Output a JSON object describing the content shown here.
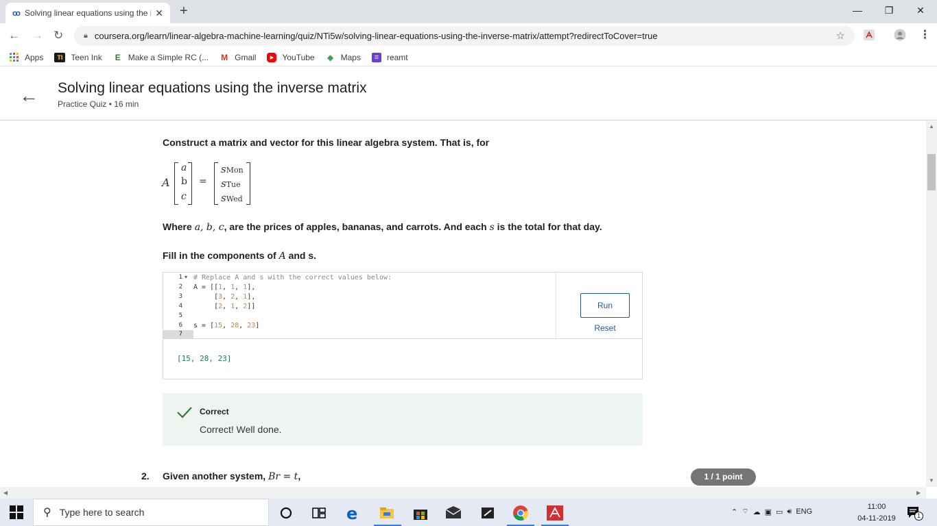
{
  "browser": {
    "tab_title": "Solving linear equations using the inverse matrix",
    "tab_close": "✕",
    "new_tab": "+",
    "url": "coursera.org/learn/linear-algebra-machine-learning/quiz/NTi5w/solving-linear-equations-using-the-inverse-matrix/attempt?redirectToCover=true",
    "window_buttons": [
      "—",
      "❐",
      "✕"
    ]
  },
  "bookmarks": [
    {
      "label": "Apps",
      "icon": "apps-grid-icon",
      "color": "#4285f4"
    },
    {
      "label": "Teen Ink",
      "icon": "teen-ink-icon",
      "color": "#1a1a1a",
      "glyph": "TI"
    },
    {
      "label": "Make a Simple RC (...",
      "icon": "instructables-icon",
      "color": "#2e7d32",
      "glyph": "E"
    },
    {
      "label": "Gmail",
      "icon": "gmail-icon",
      "color": "#d93025",
      "glyph": "M"
    },
    {
      "label": "YouTube",
      "icon": "youtube-icon",
      "color": "#ff0000",
      "glyph": "▶"
    },
    {
      "label": "Maps",
      "icon": "maps-icon",
      "color": "#34a853",
      "glyph": "◆"
    },
    {
      "label": "reamt",
      "icon": "reamt-icon",
      "color": "#6a3fd1",
      "glyph": "≡"
    }
  ],
  "header": {
    "title": "Solving linear equations using the inverse matrix",
    "subtitle": "Practice Quiz • 16 min"
  },
  "question1": {
    "prompt": "Construct a matrix and vector for this linear algebra system. That is, for",
    "equation": {
      "matrix": "A",
      "vars": [
        "a",
        "b",
        "c"
      ],
      "equals": "=",
      "rhs": [
        "Mon",
        "Tue",
        "Wed"
      ],
      "rhs_symbol": "s"
    },
    "where_text": {
      "pre": "Where ",
      "vars": "a, b, c",
      "mid": ", are the prices of apples, bananas, and carrots. And each ",
      "s": "s",
      "post": " is the total for that day."
    },
    "fill_text": {
      "pre": "Fill in the components of ",
      "A": "A",
      "post": " and s."
    },
    "editor": {
      "line_numbers": [
        "1",
        "2",
        "3",
        "4",
        "5",
        "6",
        "7"
      ],
      "fold_marker": "▾",
      "lines": [
        "# Replace A and s with the correct values below:",
        "A = [[1, 1, 1],",
        "     [3, 2, 1],",
        "     [2, 1, 2]]",
        "",
        "s = [15, 28, 23]",
        ""
      ],
      "run_label": "Run",
      "reset_label": "Reset"
    },
    "output": "[15, 28, 23]",
    "feedback": {
      "title": "Correct",
      "message": "Correct! Well done.",
      "color": "#2e7d32"
    }
  },
  "question2": {
    "number": "2.",
    "text_pre": "Given another system, ",
    "math": "Br = t",
    "text_post": ",",
    "points": "1 / 1 point"
  },
  "taskbar": {
    "search_placeholder": "Type here to search",
    "tray_lang": "ENG",
    "time": "11:00",
    "date": "04-11-2019",
    "notification_count": "1"
  }
}
